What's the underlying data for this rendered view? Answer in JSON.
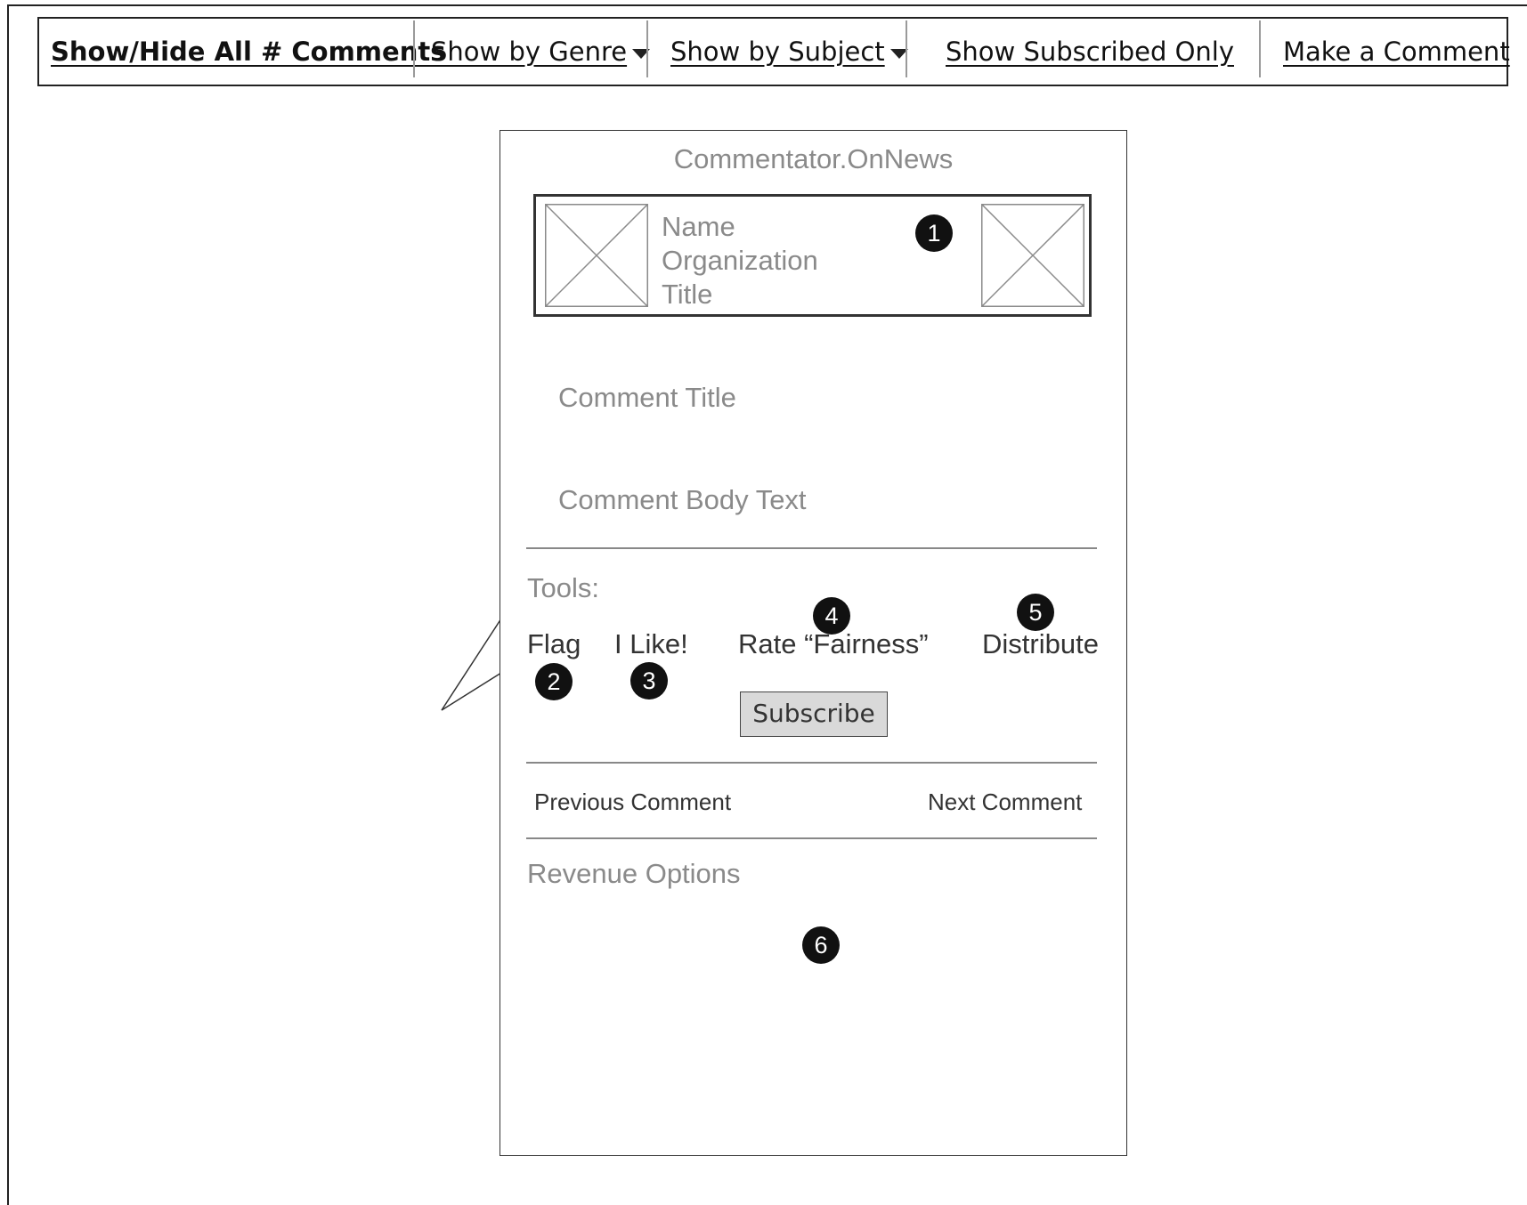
{
  "nav": {
    "show_hide_all": "Show/Hide All # Comments",
    "by_genre": "Show by Genre",
    "by_subject": "Show by Subject",
    "subscribed_only": "Show Subscribed Only",
    "make_comment": "Make a Comment"
  },
  "panel": {
    "brand": "Commentator.OnNews",
    "profile": {
      "name": "Name",
      "organization": "Organization",
      "title": "Title"
    },
    "comment_title": "Comment Title",
    "comment_body": "Comment Body Text",
    "tools_label": "Tools:",
    "tools": {
      "flag": "Flag",
      "like": "I Like!",
      "rate": "Rate “Fairness”",
      "distribute": "Distribute"
    },
    "subscribe": "Subscribe",
    "previous": "Previous Comment",
    "next": "Next Comment",
    "revenue": "Revenue Options"
  },
  "annotations": {
    "n1": "1",
    "n2": "2",
    "n3": "3",
    "n4": "4",
    "n5": "5",
    "n6": "6"
  }
}
